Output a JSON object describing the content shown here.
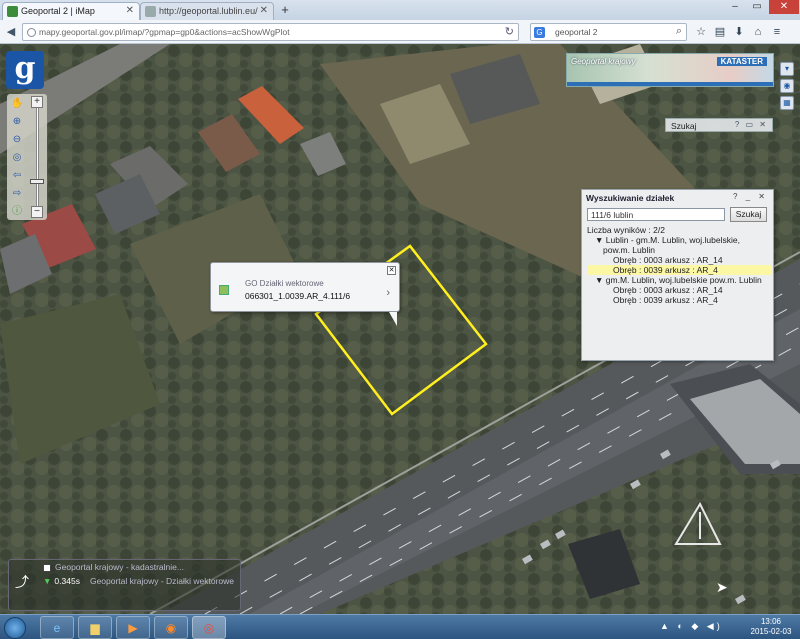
{
  "browser": {
    "tabs": [
      {
        "label": "Geoportal 2 | iMap",
        "active": true
      },
      {
        "label": "http://geoportal.lublin.eu/",
        "active": false
      }
    ],
    "url": "mapy.geoportal.gov.pl/imap/?gpmap=gp0&actions=acShowWgPlot",
    "search_engine": "G",
    "search_text": "geoportal 2",
    "window_controls": {
      "minimize": "–",
      "maximize": "▭",
      "close": "✕"
    }
  },
  "map": {
    "overview": {
      "label": "Geoportal krajowy",
      "badge": "KATASTER"
    },
    "search_mini": {
      "label": "Szukaj",
      "controls": "? ▭ ✕"
    },
    "panel": {
      "title": "Wyszukiwanie działek",
      "controls": "? _ ✕",
      "input_value": "111/6 lublin",
      "search_button": "Szukaj",
      "result_count": "Liczba wyników : 2/2",
      "results": [
        {
          "text": "▼ Lublin - gm.M. Lublin, woj.lubelskie,",
          "level": 1
        },
        {
          "text": "pow.m. Lublin",
          "level": 3
        },
        {
          "text": "Obręb : 0003 arkusz : AR_14",
          "level": 2
        },
        {
          "text": "Obręb : 0039 arkusz : AR_4",
          "level": 2,
          "highlight": true
        },
        {
          "text": "▼ gm.M. Lublin, woj.lubelskie pow.m. Lublin",
          "level": 1
        },
        {
          "text": "Obręb : 0003 arkusz : AR_14",
          "level": 2
        },
        {
          "text": "Obręb : 0039 arkusz : AR_4",
          "level": 2
        }
      ]
    },
    "popup": {
      "layer_name": "GO Działki wektorowe",
      "parcel_id": "066301_1.0039.AR_4.111/6",
      "close": "✕",
      "arrow": "›"
    },
    "layers": {
      "rows": [
        {
          "name": "Geoportal krajowy - kadastralnie..."
        },
        {
          "percent": "0.345s",
          "name": "Geoportal krajowy - Działki wektorowe"
        }
      ]
    },
    "highlight_color": "#ffef1e"
  },
  "taskbar": {
    "apps": [
      "ie",
      "explorer",
      "media",
      "firefox",
      "chrome"
    ],
    "tray": "▲ ◐ ◆ ◀)",
    "time": "13:06",
    "date": "2015-02-03"
  }
}
